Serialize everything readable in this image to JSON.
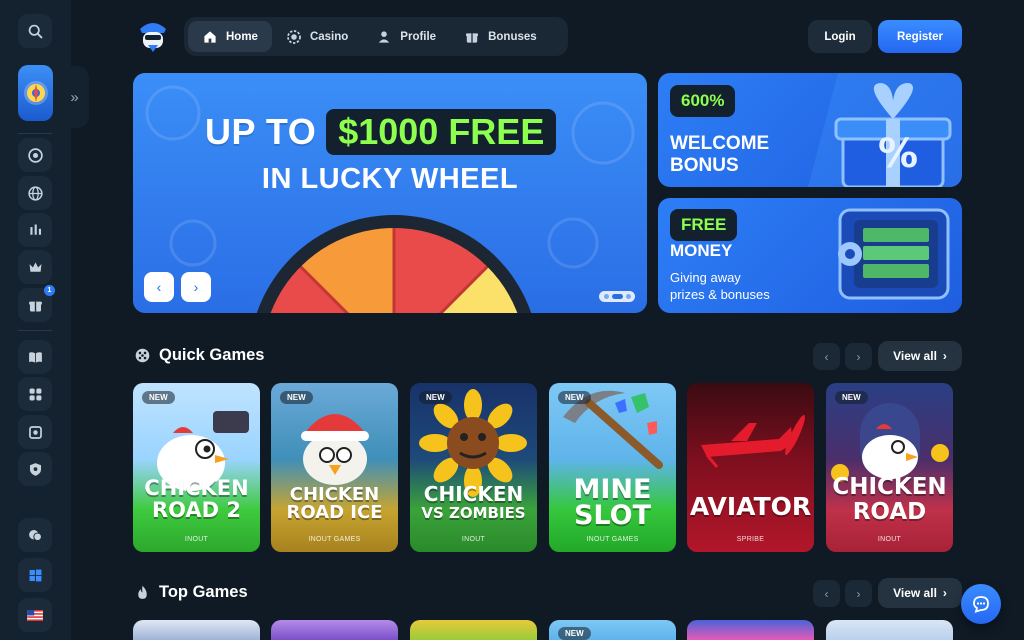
{
  "header": {
    "nav": [
      {
        "label": "Home",
        "icon": "home-icon",
        "active": true
      },
      {
        "label": "Casino",
        "icon": "casino-chip-icon",
        "active": false
      },
      {
        "label": "Profile",
        "icon": "user-icon",
        "active": false
      },
      {
        "label": "Bonuses",
        "icon": "gift-icon",
        "active": false
      }
    ],
    "login_label": "Login",
    "register_label": "Register"
  },
  "sidebar": {
    "badge_count": "1",
    "items": [
      "search-icon",
      "wheel-promo-icon",
      "casino-chip-icon",
      "globe-icon",
      "chart-icon",
      "crown-icon",
      "gift-icon",
      "book-icon",
      "gamepad-icon",
      "safe-icon",
      "shield-icon",
      "chat-icon",
      "windows-icon",
      "us-flag-icon"
    ]
  },
  "hero": {
    "line1_prefix": "UP TO",
    "line1_highlight": "$1000 FREE",
    "line2": "IN LUCKY WHEEL"
  },
  "promos": [
    {
      "tag": "600%",
      "title_1": "WELCOME",
      "title_2": "BONUS"
    },
    {
      "tag": "FREE",
      "title_1": "MONEY",
      "subtitle_1": "Giving away",
      "subtitle_2": "prizes & bonuses"
    }
  ],
  "sections": {
    "quick_games": {
      "title": "Quick Games",
      "view_all": "View all"
    },
    "top_games": {
      "title": "Top Games",
      "view_all": "View all"
    }
  },
  "quick_games": [
    {
      "name_1": "CHICKEN",
      "name_2": "ROAD 2",
      "provider": "INOUT",
      "badge": "NEW"
    },
    {
      "name_1": "CHICKEN",
      "name_2": "ROAD ICE",
      "provider": "INOUT GAMES",
      "badge": "NEW"
    },
    {
      "name_1": "CHICKEN",
      "name_2": "VS ZOMBIES",
      "provider": "INOUT",
      "badge": "NEW"
    },
    {
      "name_1": "MINE",
      "name_2": "SLOT",
      "provider": "INOUT GAMES",
      "badge": "NEW"
    },
    {
      "name_1": "AVIATOR",
      "name_2": "",
      "provider": "SPRIBE",
      "badge": ""
    },
    {
      "name_1": "CHICKEN",
      "name_2": "ROAD",
      "provider": "INOUT",
      "badge": "NEW"
    }
  ],
  "top_games_badge": "NEW",
  "colors": {
    "accent": "#2f7cf6",
    "highlight_green": "#8dff4e",
    "background": "#0f1a25"
  }
}
